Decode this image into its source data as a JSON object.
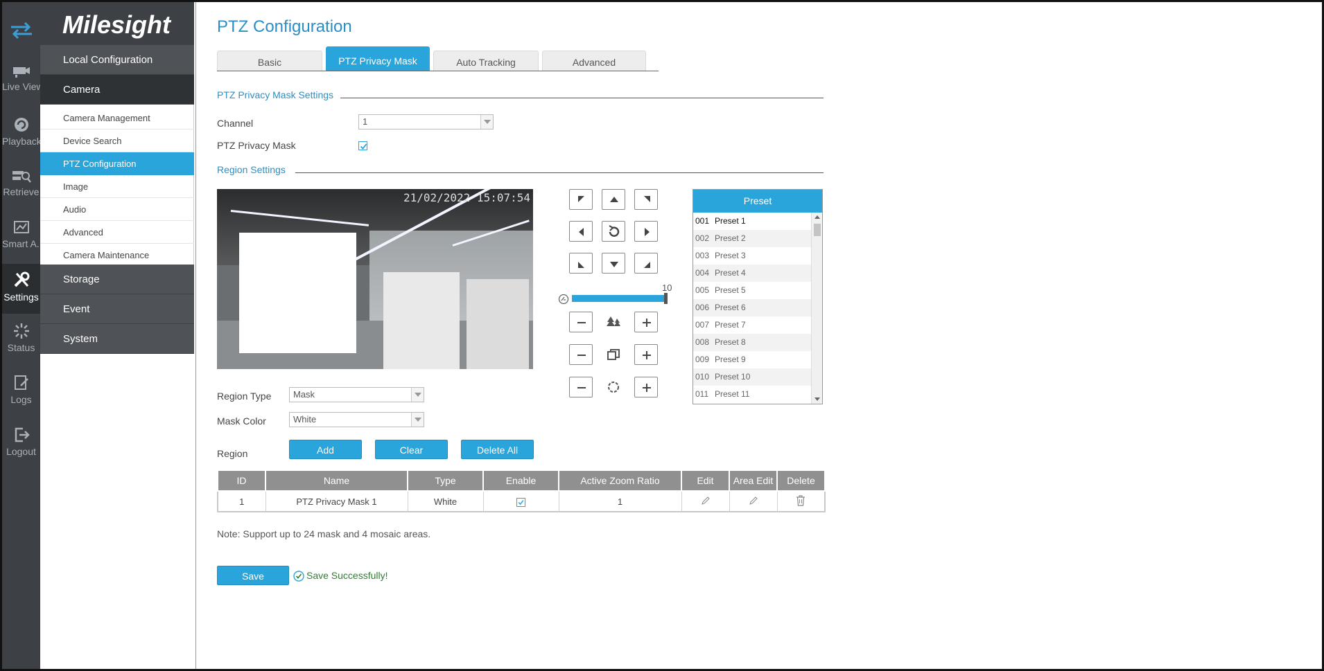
{
  "nav": [
    {
      "label": "",
      "icon": "swap-arrows-icon"
    },
    {
      "label": "Live View",
      "icon": "live-view-icon"
    },
    {
      "label": "Playback",
      "icon": "playback-icon"
    },
    {
      "label": "Retrieve",
      "icon": "retrieve-icon"
    },
    {
      "label": "Smart A...",
      "icon": "smart-analytics-icon"
    },
    {
      "label": "Settings",
      "icon": "settings-icon"
    },
    {
      "label": "Status",
      "icon": "status-icon"
    },
    {
      "label": "Logs",
      "icon": "logs-icon"
    },
    {
      "label": "Logout",
      "icon": "logout-icon"
    }
  ],
  "brand": "Milesight",
  "sidebar": {
    "main": [
      "Local Configuration",
      "Camera",
      "Storage",
      "Event",
      "System"
    ],
    "sub": [
      "Camera Management",
      "Device Search",
      "PTZ Configuration",
      "Image",
      "Audio",
      "Advanced",
      "Camera Maintenance"
    ]
  },
  "page": {
    "title": "PTZ Configuration",
    "tabs": [
      "Basic",
      "PTZ Privacy Mask",
      "Auto Tracking",
      "Advanced"
    ]
  },
  "mask_settings": {
    "section": "PTZ Privacy Mask Settings",
    "channel_label": "Channel",
    "channel_value": "1",
    "privacy_mask_label": "PTZ Privacy Mask",
    "privacy_mask_checked": true
  },
  "region_settings": {
    "section": "Region Settings",
    "timestamp": "21/02/2022 15:07:54",
    "region_type_label": "Region Type",
    "region_type_value": "Mask",
    "mask_color_label": "Mask Color",
    "mask_color_value": "White",
    "region_label": "Region",
    "add": "Add",
    "clear": "Clear",
    "delete_all": "Delete All"
  },
  "ptz": {
    "speed_value": "10",
    "speed_level": 10,
    "speed_max": 10
  },
  "preset": {
    "header": "Preset",
    "items": [
      {
        "num": "001",
        "name": "Preset 1"
      },
      {
        "num": "002",
        "name": "Preset 2"
      },
      {
        "num": "003",
        "name": "Preset 3"
      },
      {
        "num": "004",
        "name": "Preset 4"
      },
      {
        "num": "005",
        "name": "Preset 5"
      },
      {
        "num": "006",
        "name": "Preset 6"
      },
      {
        "num": "007",
        "name": "Preset 7"
      },
      {
        "num": "008",
        "name": "Preset 8"
      },
      {
        "num": "009",
        "name": "Preset 9"
      },
      {
        "num": "010",
        "name": "Preset 10"
      },
      {
        "num": "011",
        "name": "Preset 11"
      }
    ]
  },
  "table": {
    "headers": [
      "ID",
      "Name",
      "Type",
      "Enable",
      "Active Zoom Ratio",
      "Edit",
      "Area Edit",
      "Delete"
    ],
    "rows": [
      {
        "id": "1",
        "name": "PTZ Privacy Mask 1",
        "type": "White",
        "enable": true,
        "zoom": "1"
      }
    ]
  },
  "note": "Note: Support up to 24 mask and 4 mosaic areas.",
  "save_label": "Save",
  "save_message": "Save Successfully!",
  "colors": {
    "accent": "#2aa5dc",
    "sidebar_dark": "#3d4145",
    "success": "#2e7d32"
  }
}
